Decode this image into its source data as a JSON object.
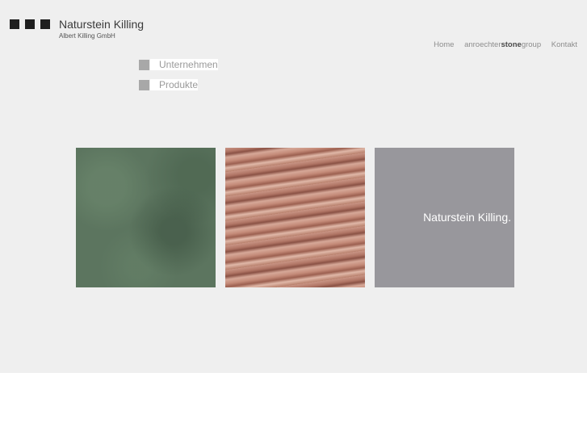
{
  "brand": {
    "name": "Naturstein Killing",
    "subtitle": "Albert Killing GmbH"
  },
  "topnav": {
    "home": "Home",
    "group_prefix": "anroechter",
    "group_bold": "stone",
    "group_suffix": "group",
    "contact": "Kontakt"
  },
  "menu": {
    "items": [
      {
        "label": "Unternehmen"
      },
      {
        "label": "Produkte"
      }
    ]
  },
  "tiles": {
    "caption": "Naturstein Killing."
  },
  "colors": {
    "background": "#efefef",
    "logo_squares": "#1f1f1f",
    "menu_marker": "#a8a8a8",
    "text_tile": "#98979c",
    "green_stone": "#5c755f",
    "marble_stone": "#b98070"
  }
}
